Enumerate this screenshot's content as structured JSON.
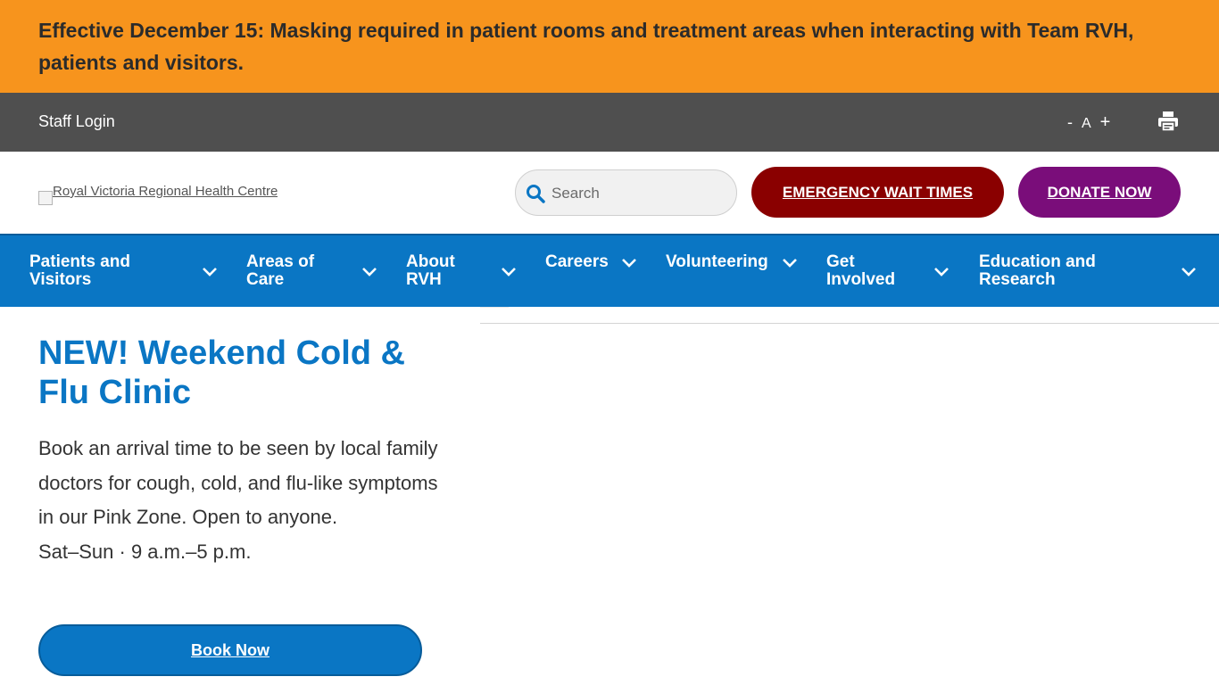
{
  "alert": {
    "text": "Effective December 15: Masking required in patient rooms and treatment areas when interacting with Team RVH, patients and visitors."
  },
  "utility": {
    "staff_login": "Staff Login",
    "font_decrease": "-",
    "font_label": "A",
    "font_increase": "+",
    "print_icon": "print-icon"
  },
  "header": {
    "logo_alt": "Royal Victoria Regional Health Centre",
    "search_placeholder": "Search",
    "emergency_button": "EMERGENCY WAIT TIMES",
    "donate_button": "DONATE NOW"
  },
  "nav": {
    "items": [
      {
        "line1": "Patients and",
        "line2": "Visitors"
      },
      {
        "line1": "Areas of",
        "line2": "Care"
      },
      {
        "line1": "About",
        "line2": "RVH"
      },
      {
        "line1": "Careers",
        "line2": ""
      },
      {
        "line1": "Volunteering",
        "line2": ""
      },
      {
        "line1": "Get",
        "line2": "Involved"
      },
      {
        "line1": "Education and",
        "line2": "Research"
      }
    ]
  },
  "promo": {
    "title": "NEW! Weekend Cold & Flu Clinic",
    "body": "Book an arrival time to be seen by local family doctors for cough, cold, and flu-like symptoms in our Pink Zone. Open to anyone.",
    "hours": "Sat–Sun · 9 a.m.–5 p.m.",
    "button": "Book Now"
  },
  "colors": {
    "alert": "#f7941d",
    "utility_bar": "#4f4f4f",
    "nav": "#0a76c4",
    "emergency": "#8a0000",
    "donate": "#7a0d7a"
  }
}
